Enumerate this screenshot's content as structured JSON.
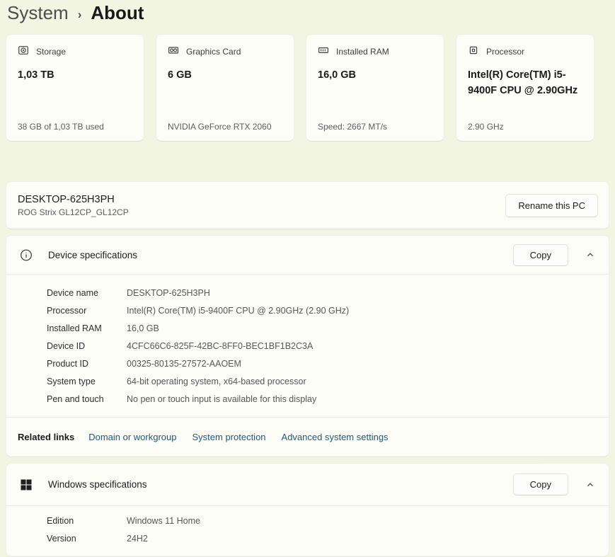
{
  "breadcrumb": {
    "parent": "System",
    "separator": "›",
    "current": "About"
  },
  "cards": [
    {
      "icon": "storage-icon",
      "label": "Storage",
      "value": "1,03 TB",
      "detail": "38 GB of 1,03 TB used"
    },
    {
      "icon": "gpu-icon",
      "label": "Graphics Card",
      "value": "6 GB",
      "detail": "NVIDIA GeForce RTX 2060"
    },
    {
      "icon": "ram-icon",
      "label": "Installed RAM",
      "value": "16,0 GB",
      "detail": "Speed: 2667 MT/s"
    },
    {
      "icon": "cpu-icon",
      "label": "Processor",
      "value": "Intel(R) Core(TM) i5-9400F CPU @ 2.90GHz",
      "detail": "2.90 GHz"
    }
  ],
  "device_bar": {
    "name": "DESKTOP-625H3PH",
    "model": "ROG Strix GL12CP_GL12CP",
    "rename_button": "Rename this PC"
  },
  "device_specs": {
    "icon": "info-icon",
    "title": "Device specifications",
    "copy_button": "Copy",
    "expanded": true,
    "rows": [
      {
        "label": "Device name",
        "value": "DESKTOP-625H3PH"
      },
      {
        "label": "Processor",
        "value": "Intel(R) Core(TM) i5-9400F CPU @ 2.90GHz (2.90 GHz)"
      },
      {
        "label": "Installed RAM",
        "value": "16,0 GB"
      },
      {
        "label": "Device ID",
        "value": "4CFC66C6-825F-42BC-8FF0-BEC1BF1B2C3A"
      },
      {
        "label": "Product ID",
        "value": "00325-80135-27572-AAOEM"
      },
      {
        "label": "System type",
        "value": "64-bit operating system, x64-based processor"
      },
      {
        "label": "Pen and touch",
        "value": "No pen or touch input is available for this display"
      }
    ],
    "related_links": {
      "label": "Related links",
      "links": [
        "Domain or workgroup",
        "System protection",
        "Advanced system settings"
      ]
    }
  },
  "windows_specs": {
    "icon": "windows-logo-icon",
    "title": "Windows specifications",
    "copy_button": "Copy",
    "expanded": true,
    "rows": [
      {
        "label": "Edition",
        "value": "Windows 11 Home"
      },
      {
        "label": "Version",
        "value": "24H2"
      }
    ]
  },
  "colors": {
    "page_background": "#f1f5e2",
    "card_background": "#fcfdf7",
    "link": "#1a5a7e",
    "text_primary": "#1b1b1b",
    "text_secondary": "#5d5d5d"
  }
}
